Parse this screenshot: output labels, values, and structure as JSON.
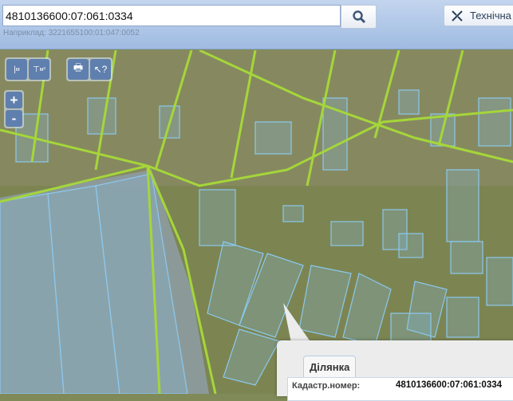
{
  "search": {
    "value": "4810136600:07:061:0334",
    "hint": "Наприклад: 3221655100:01:047:0052"
  },
  "toolbar": {
    "tech_label": "Технічна"
  },
  "tools": {
    "measure_length": "м",
    "measure_area": "м²",
    "zoom_in": "+",
    "zoom_out": "-"
  },
  "popup": {
    "tab": "Ділянка",
    "fields": [
      {
        "label": "Кадастр.номер:",
        "value": "4810136600:07:061:0334"
      }
    ]
  },
  "colors": {
    "parcel": "#7fc8f0",
    "road": "#9acd32",
    "header": "#a9c3e6"
  }
}
